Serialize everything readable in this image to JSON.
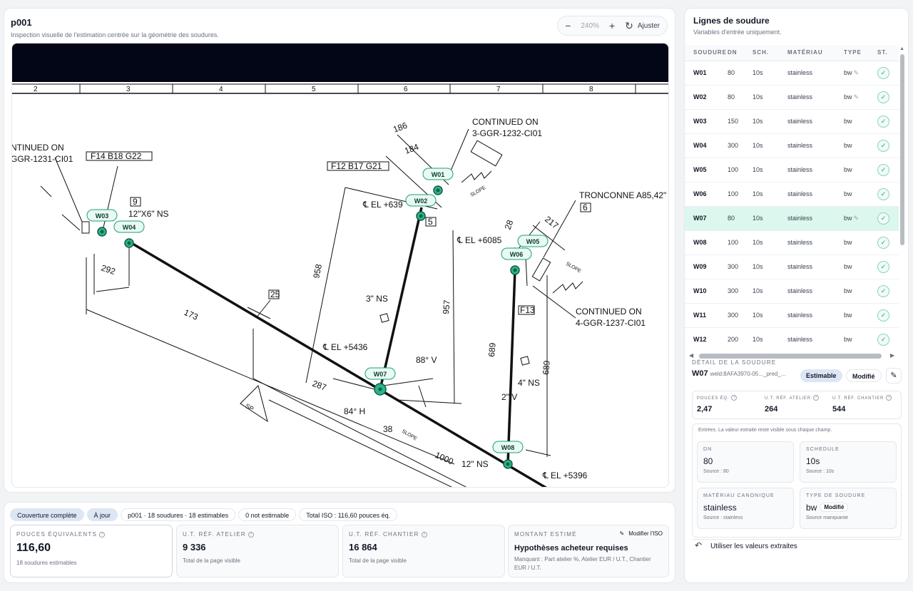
{
  "viewer": {
    "title": "p001",
    "subtitle": "Inspection visuelle de l'estimation centrée sur la géométrie des soudures.",
    "zoom": "240%",
    "fit_label": "Ajuster",
    "ruler": [
      "2",
      "3",
      "4",
      "5",
      "6",
      "7",
      "8"
    ],
    "iso_text": {
      "continued_left_1": "NTINUED ON",
      "continued_left_2": "GGR-1231-CI01",
      "f14": "F14 B18 G22",
      "f12": "F12 B17 G21",
      "continued_top_1": "CONTINUED ON",
      "continued_top_2": "3-GGR-1232-CI01",
      "tronconne": "TRONCONNE A85,42\"",
      "n6": "6",
      "n9": "9",
      "size1": "12\"X6\" NS",
      "d292": "292",
      "d173": "173",
      "n25": "25",
      "d958": "958",
      "el6391": "℄ EL +639",
      "n5": "5",
      "el6085": "℄ EL +6085",
      "ns3": "3\" NS",
      "d957": "957",
      "el5436": "℄ EL +5436",
      "ang88": "88° V",
      "d287": "287",
      "ang84": "84° H",
      "d38": "38",
      "d1000": "1000",
      "ns12": "12\" NS",
      "el5396": "℄ EL +5396",
      "d689a": "689",
      "d689b": "689",
      "ns2": "2\" V",
      "ns4": "4\" NS",
      "f13": "F13",
      "continued_right_1": "CONTINUED ON",
      "continued_right_2": "4-GGR-1237-CI01",
      "d186": "186",
      "d184": "184",
      "d28": "28",
      "d217": "217",
      "slope": "SLOPE",
      "sp": "SP"
    },
    "markers": [
      {
        "id": "W01"
      },
      {
        "id": "W02"
      },
      {
        "id": "W03"
      },
      {
        "id": "W04"
      },
      {
        "id": "W05"
      },
      {
        "id": "W06"
      },
      {
        "id": "W07"
      },
      {
        "id": "W08"
      }
    ]
  },
  "stats": {
    "chips": [
      "Couverture complète",
      "À jour",
      "p001 · 18 soudures · 18 estimables",
      "0 not estimable",
      "Total ISO : 116,60 pouces éq."
    ],
    "pouces": {
      "label": "POUCES ÉQUIVALENTS",
      "value": "116,60",
      "note": "18 soudures estimables"
    },
    "atelier": {
      "label": "U.T. RÉF. ATELIER",
      "value": "9 336",
      "note": "Total de la page visible"
    },
    "chantier": {
      "label": "U.T. RÉF. CHANTIER",
      "value": "16 864",
      "note": "Total de la page visible"
    },
    "montant": {
      "label": "MONTANT ESTIMÉ",
      "edit_label": "Modifier l'ISO",
      "value": "Hypothèses acheteur requises",
      "note": "Manquant : Part atelier %, Atelier EUR / U.T., Chantier EUR / U.T."
    }
  },
  "side": {
    "title": "Lignes de soudure",
    "subtitle": "Variables d'entrée uniquement.",
    "columns": [
      "SOUDURE",
      "DN",
      "SCH.",
      "MATÉRIAU",
      "TYPE",
      "ST."
    ],
    "rows": [
      {
        "id": "W01",
        "dn": "80",
        "sch": "10s",
        "mat": "stainless",
        "type": "bw",
        "edited": true
      },
      {
        "id": "W02",
        "dn": "80",
        "sch": "10s",
        "mat": "stainless",
        "type": "bw",
        "edited": true
      },
      {
        "id": "W03",
        "dn": "150",
        "sch": "10s",
        "mat": "stainless",
        "type": "bw",
        "edited": false
      },
      {
        "id": "W04",
        "dn": "300",
        "sch": "10s",
        "mat": "stainless",
        "type": "bw",
        "edited": false
      },
      {
        "id": "W05",
        "dn": "100",
        "sch": "10s",
        "mat": "stainless",
        "type": "bw",
        "edited": false
      },
      {
        "id": "W06",
        "dn": "100",
        "sch": "10s",
        "mat": "stainless",
        "type": "bw",
        "edited": false
      },
      {
        "id": "W07",
        "dn": "80",
        "sch": "10s",
        "mat": "stainless",
        "type": "bw",
        "edited": true
      },
      {
        "id": "W08",
        "dn": "100",
        "sch": "10s",
        "mat": "stainless",
        "type": "bw",
        "edited": false
      },
      {
        "id": "W09",
        "dn": "300",
        "sch": "10s",
        "mat": "stainless",
        "type": "bw",
        "edited": false
      },
      {
        "id": "W10",
        "dn": "300",
        "sch": "10s",
        "mat": "stainless",
        "type": "bw",
        "edited": false
      },
      {
        "id": "W11",
        "dn": "300",
        "sch": "10s",
        "mat": "stainless",
        "type": "bw",
        "edited": false
      },
      {
        "id": "W12",
        "dn": "200",
        "sch": "10s",
        "mat": "stainless",
        "type": "bw",
        "edited": false
      }
    ],
    "selected": "W07",
    "detail": {
      "label": "DÉTAIL DE LA SOUDURE",
      "id": "W07",
      "ref": "weld:8AFA3970-05..._pred_...",
      "badge_estimable": "Estimable",
      "badge_modifie": "Modifié",
      "pouces_label": "POUCES ÉQ.",
      "pouces": "2,47",
      "atelier_label": "U.T. RÉF. ATELIER",
      "atelier": "264",
      "chantier_label": "U.T. RÉF. CHANTIER",
      "chantier": "544",
      "hint": "Entrées. La valeur extraite reste visible sous chaque champ.",
      "dn_label": "DN",
      "dn": "80",
      "dn_src": "Source : 80",
      "sch_label": "SCHEDULE",
      "sch": "10s",
      "sch_src": "Source : 10s",
      "mat_label": "MATÉRIAU CANONIQUE",
      "mat": "stainless",
      "mat_src": "Source : stainless",
      "type_label": "TYPE DE SOUDURE",
      "type": "bw",
      "type_badge": "Modifié",
      "type_src": "Source manquante",
      "use_label": "Utiliser les valeurs extraites"
    }
  },
  "colors": {
    "accent": "#2bb58a",
    "marker_fill": "#e8faf2",
    "marker_stroke": "#1f9e78",
    "selected_row": "#dcf7ed"
  }
}
